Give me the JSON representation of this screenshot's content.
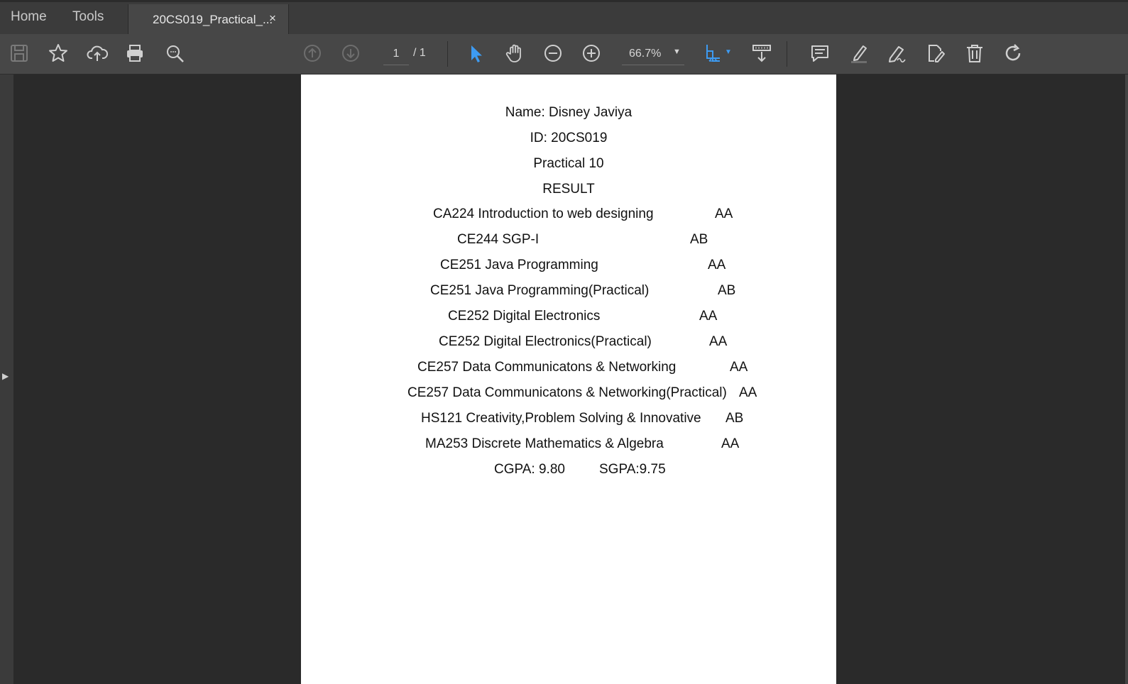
{
  "tabs": {
    "home": "Home",
    "tools": "Tools",
    "document": "20CS019_Practical_...",
    "close": "×"
  },
  "toolbar": {
    "icons": [
      "save-icon",
      "bookmark-star-icon",
      "upload-cloud-icon",
      "print-icon",
      "zoom-search-icon",
      "prev-page-icon",
      "next-page-icon",
      "select-cursor-icon",
      "hand-icon",
      "zoom-out-icon",
      "zoom-in-icon",
      "fit-page-icon",
      "scroll-mode-icon",
      "comment-icon",
      "highlight-icon",
      "sign-icon",
      "edit-pdf-icon",
      "delete-icon",
      "rotate-icon"
    ],
    "current_page": "1",
    "total_pages": "/  1",
    "zoom": "66.7%",
    "accent_color": "#3d9bf2"
  },
  "document": {
    "name": "Name: Disney Javiya",
    "id": "ID: 20CS019",
    "practical": "Practical 10",
    "heading": "RESULT",
    "courses": [
      {
        "course": "CA224 Introduction to web designing",
        "grade": "AA"
      },
      {
        "course": "CE244 SGP-I",
        "grade": "AB"
      },
      {
        "course": "CE251 Java Programming",
        "grade": "AA"
      },
      {
        "course": "CE251 Java Programming(Practical)",
        "grade": "AB"
      },
      {
        "course": "CE252 Digital Electronics",
        "grade": "AA"
      },
      {
        "course": "CE252 Digital Electronics(Practical)",
        "grade": "AA"
      },
      {
        "course": "CE257 Data Communicatons & Networking",
        "grade": "AA"
      },
      {
        "course": "CE257 Data Communicatons & Networking(Practical)",
        "grade": "AA"
      },
      {
        "course": "HS121 Creativity,Problem Solving & Innovative",
        "grade": "AB"
      },
      {
        "course": "MA253 Discrete Mathematics & Algebra",
        "grade": "AA"
      }
    ],
    "cgpa": "CGPA: 9.80",
    "sgpa": "SGPA:9.75"
  }
}
